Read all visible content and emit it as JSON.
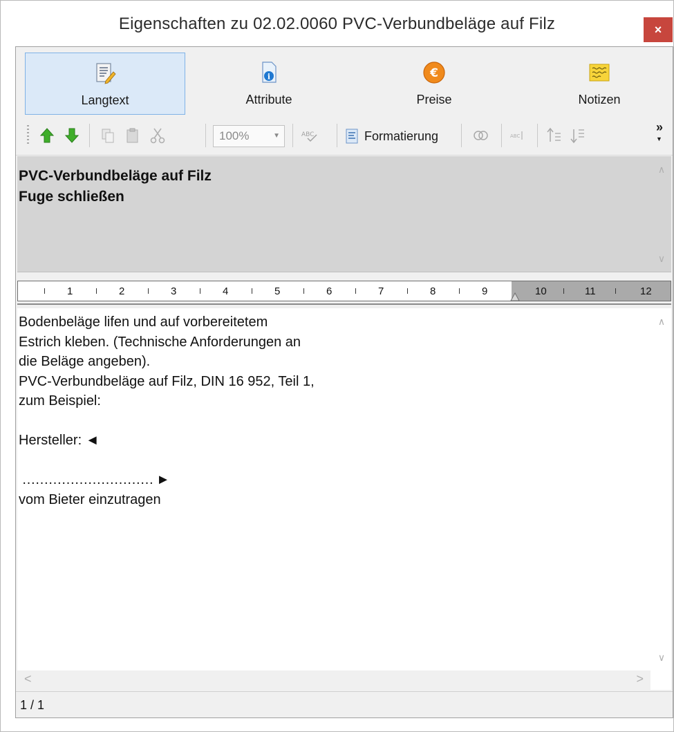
{
  "window": {
    "title": "Eigenschaften zu 02.02.0060 PVC-Verbundbeläge auf Filz",
    "close_glyph": "×"
  },
  "tabs": [
    {
      "label": "Langtext",
      "icon": "document-pen-icon",
      "active": true
    },
    {
      "label": "Attribute",
      "icon": "info-document-icon",
      "active": false
    },
    {
      "label": "Preise",
      "icon": "euro-icon",
      "active": false
    },
    {
      "label": "Notizen",
      "icon": "note-icon",
      "active": false
    }
  ],
  "toolbar": {
    "zoom_value": "100%",
    "format_label": "Formatierung",
    "more_glyph": "»"
  },
  "short_text": {
    "lines": [
      "PVC-Verbundbeläge auf Filz",
      "Fuge schließen"
    ]
  },
  "ruler": {
    "numbers": [
      "1",
      "2",
      "3",
      "4",
      "5",
      "6",
      "7",
      "8",
      "9",
      "10",
      "11",
      "12"
    ]
  },
  "long_text": {
    "lines": [
      "Bodenbeläge lifen und auf vorbereitetem",
      "Estrich kleben. (Technische Anforderungen an",
      "die Beläge angeben).",
      "PVC-Verbundbeläge auf Filz, DIN 16 952, Teil 1,",
      "zum Beispiel:",
      "",
      "Hersteller: ◄",
      "",
      " ………………………… ►",
      "vom Bieter einzutragen"
    ]
  },
  "status": {
    "page": "1 / 1"
  },
  "colors": {
    "close": "#c7463d",
    "active_tab": "#dbe9f8",
    "active_tab_border": "#7fb2e6",
    "green_arrow": "#3fae2a",
    "short_text_bg": "#d4d4d4",
    "ruler_gray": "#aaaaaa"
  }
}
